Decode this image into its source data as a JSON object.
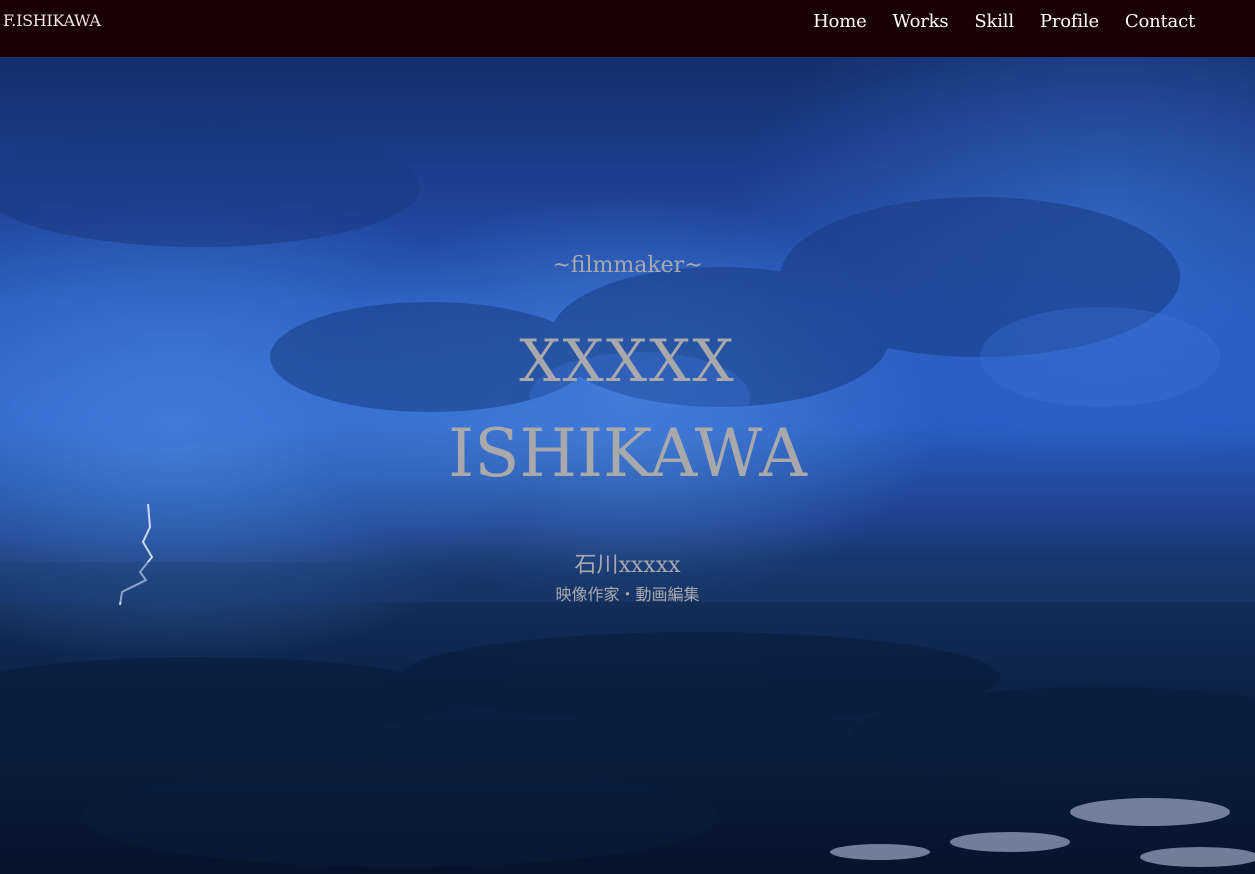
{
  "header": {
    "brand": "F.ISHIKAWA",
    "nav": [
      {
        "label": "Home"
      },
      {
        "label": "Works"
      },
      {
        "label": "Skill"
      },
      {
        "label": "Profile"
      },
      {
        "label": "Contact"
      }
    ],
    "background_color": "#1a0202"
  },
  "hero": {
    "tagline": "~filmmaker~",
    "first_name": "XXXXX",
    "last_name": "ISHIKAWA",
    "japanese_name": "石川xxxxx",
    "japanese_role": "映像作家・動画編集",
    "text_color": "#a9a9ac"
  }
}
